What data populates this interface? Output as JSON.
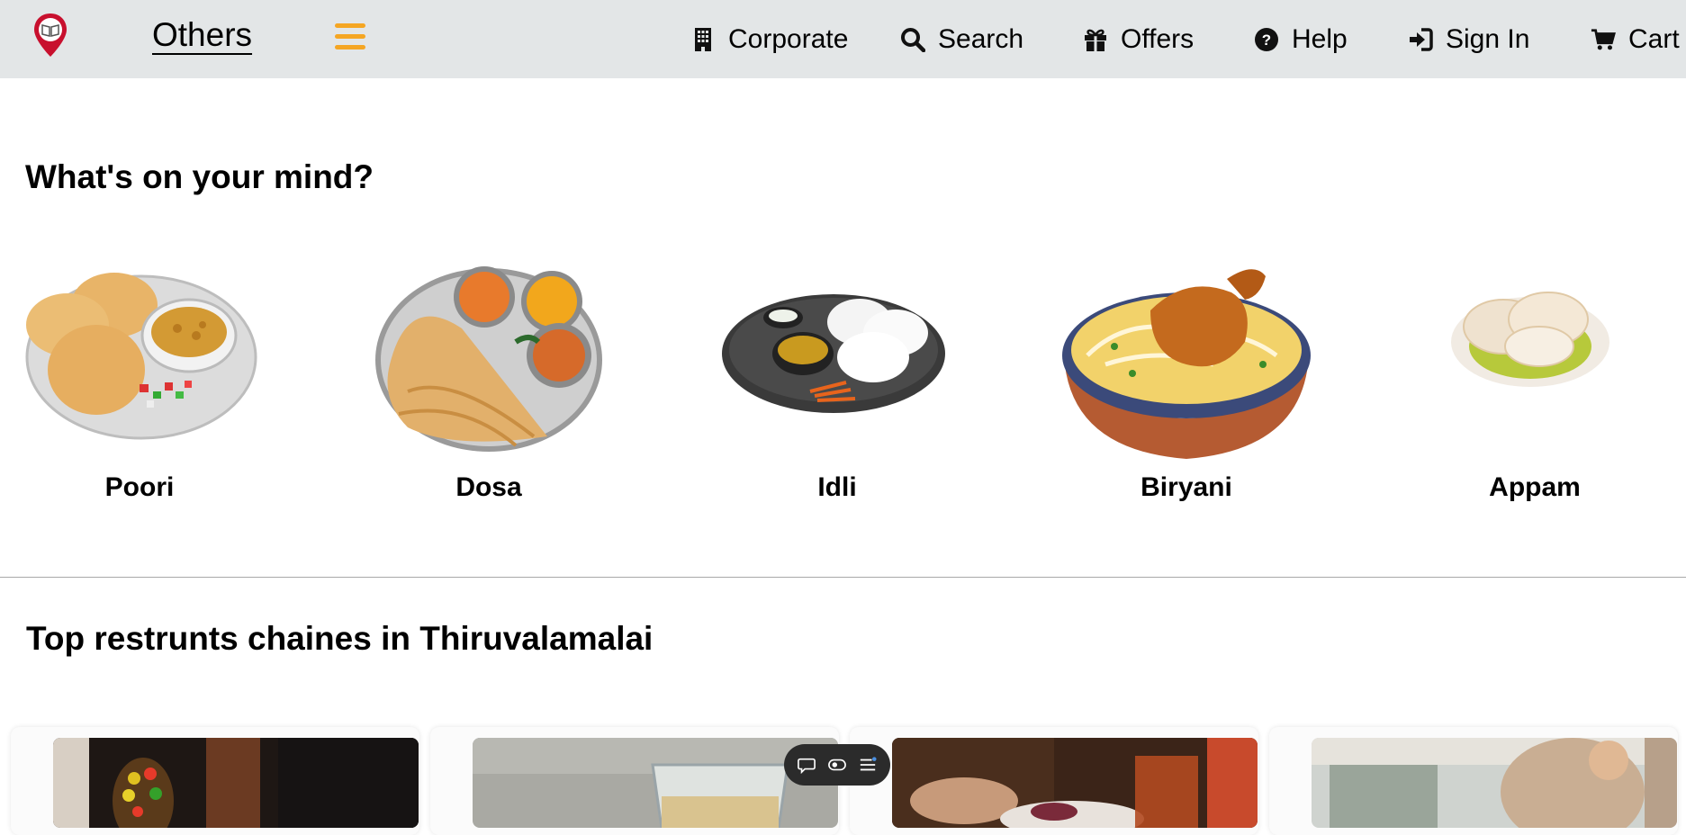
{
  "header": {
    "brand": "Others",
    "nav": {
      "corporate": "Corporate",
      "search": "Search",
      "offers": "Offers",
      "help": "Help",
      "sign_in": "Sign In",
      "cart": "Cart"
    },
    "icons": {
      "logo": "map-pin-book-icon",
      "menu": "hamburger-menu-icon",
      "corporate": "building-icon",
      "search": "search-icon",
      "offers": "gift-icon",
      "help": "question-circle-icon",
      "sign_in": "sign-in-icon",
      "cart": "cart-icon"
    }
  },
  "categories": {
    "heading": "What's on your mind?",
    "items": [
      {
        "label": "Poori"
      },
      {
        "label": "Dosa"
      },
      {
        "label": "Idli"
      },
      {
        "label": "Biryani"
      },
      {
        "label": "Appam"
      }
    ]
  },
  "restaurants": {
    "heading": "Top restrunts chaines in Thiruvalamalai",
    "cards": [
      {
        "image": "restaurant-photo-1"
      },
      {
        "image": "restaurant-photo-2"
      },
      {
        "image": "restaurant-photo-3"
      },
      {
        "image": "restaurant-photo-4"
      }
    ]
  },
  "floating_toolbar": {
    "icons": [
      "chat-icon",
      "eye-toggle-icon",
      "list-menu-icon"
    ]
  },
  "colors": {
    "header_bg": "#e3e6e7",
    "accent": "#f5a623",
    "logo_red": "#d0021b"
  }
}
